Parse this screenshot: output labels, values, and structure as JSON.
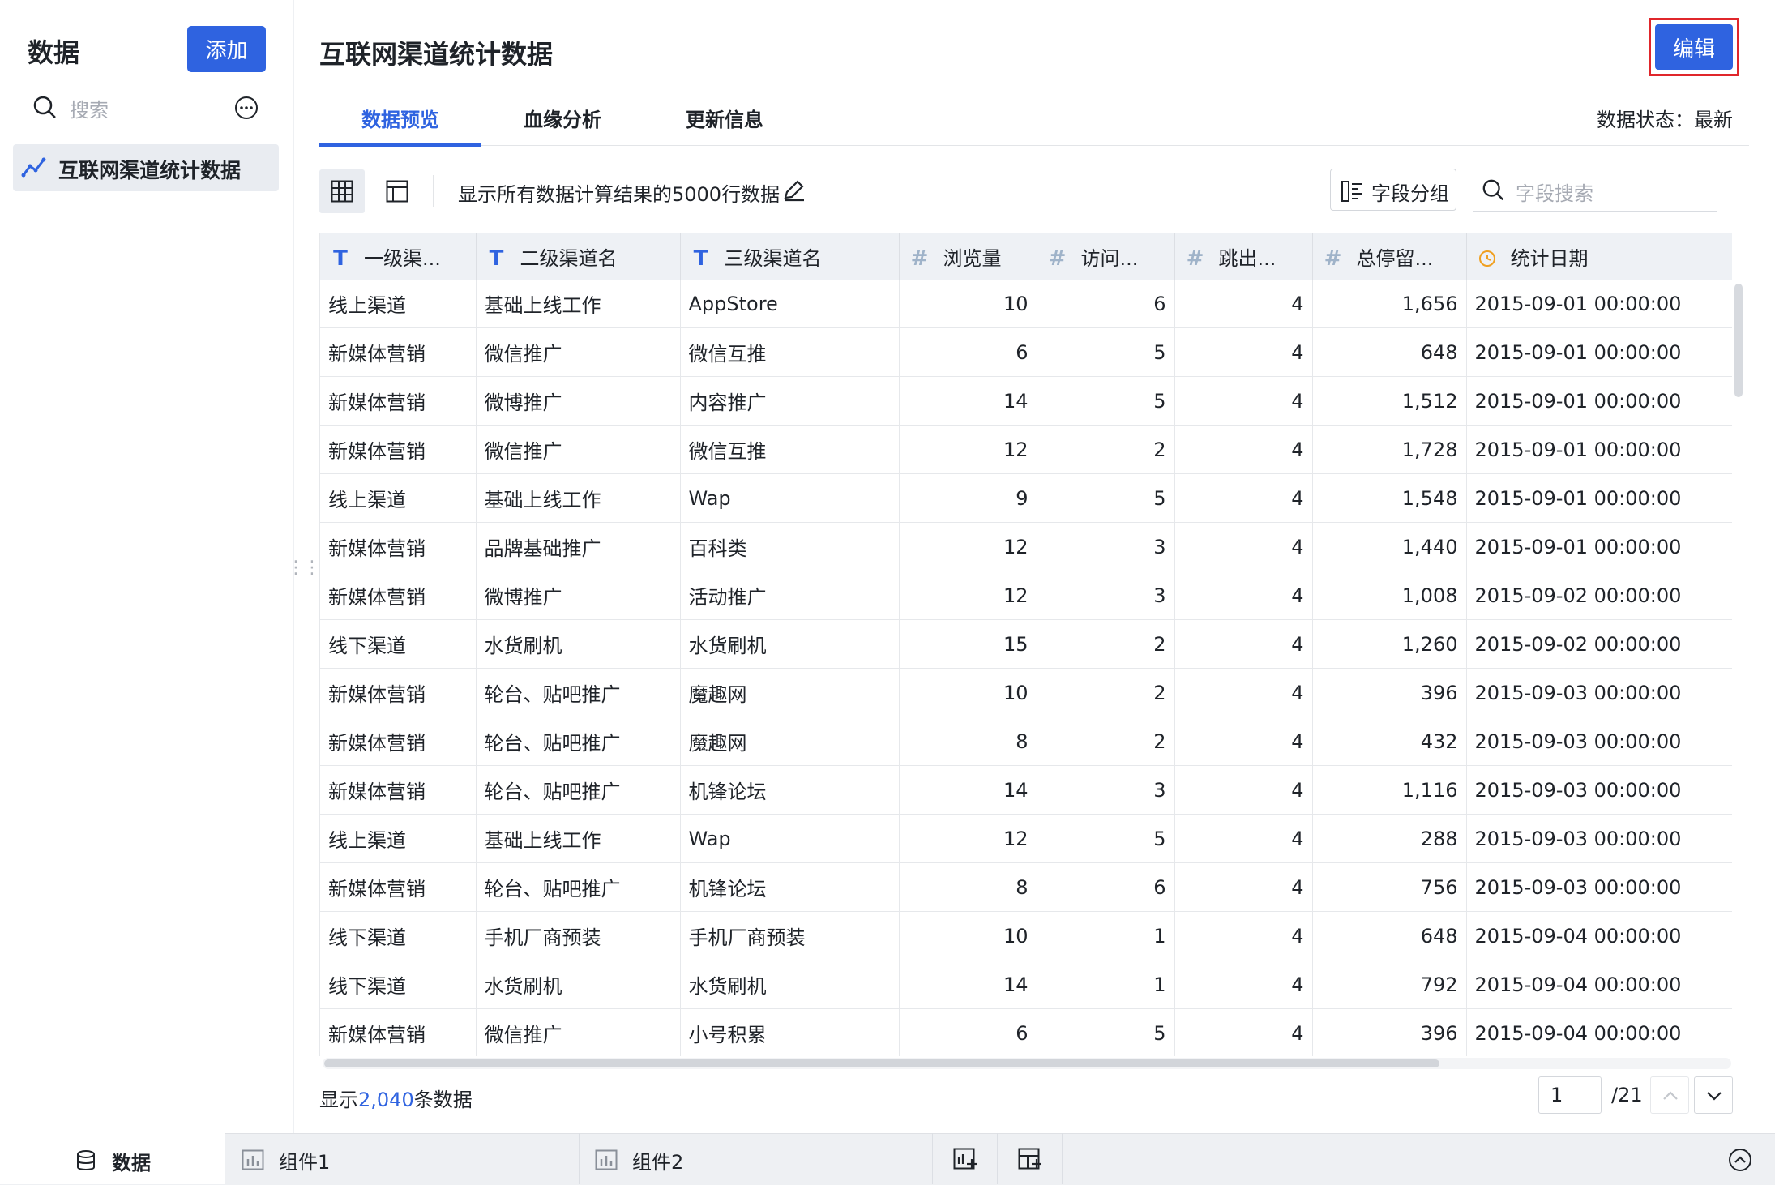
{
  "sidebar": {
    "title": "数据",
    "add_label": "添加",
    "search_placeholder": "搜索",
    "datasets": [
      {
        "label": "互联网渠道统计数据"
      }
    ]
  },
  "header": {
    "title": "互联网渠道统计数据",
    "edit_label": "编辑"
  },
  "tabs": [
    {
      "label": "数据预览",
      "active": true
    },
    {
      "label": "血缘分析",
      "active": false
    },
    {
      "label": "更新信息",
      "active": false
    }
  ],
  "status_text": "数据状态：最新",
  "toolbar": {
    "row_note": "显示所有数据计算结果的5000行数据",
    "group_label": "字段分组",
    "field_search_placeholder": "字段搜索"
  },
  "table": {
    "columns": [
      {
        "label": "一级渠...",
        "type": "text"
      },
      {
        "label": "二级渠道名",
        "type": "text"
      },
      {
        "label": "三级渠道名",
        "type": "text"
      },
      {
        "label": "浏览量",
        "type": "number"
      },
      {
        "label": "访问...",
        "type": "number"
      },
      {
        "label": "跳出...",
        "type": "number"
      },
      {
        "label": "总停留...",
        "type": "number"
      },
      {
        "label": "统计日期",
        "type": "date"
      }
    ],
    "rows": [
      [
        "线上渠道",
        "基础上线工作",
        "AppStore",
        "10",
        "6",
        "4",
        "1,656",
        "2015-09-01 00:00:00"
      ],
      [
        "新媒体营销",
        "微信推广",
        "微信互推",
        "6",
        "5",
        "4",
        "648",
        "2015-09-01 00:00:00"
      ],
      [
        "新媒体营销",
        "微博推广",
        "内容推广",
        "14",
        "5",
        "4",
        "1,512",
        "2015-09-01 00:00:00"
      ],
      [
        "新媒体营销",
        "微信推广",
        "微信互推",
        "12",
        "2",
        "4",
        "1,728",
        "2015-09-01 00:00:00"
      ],
      [
        "线上渠道",
        "基础上线工作",
        "Wap",
        "9",
        "5",
        "4",
        "1,548",
        "2015-09-01 00:00:00"
      ],
      [
        "新媒体营销",
        "品牌基础推广",
        "百科类",
        "12",
        "3",
        "4",
        "1,440",
        "2015-09-01 00:00:00"
      ],
      [
        "新媒体营销",
        "微博推广",
        "活动推广",
        "12",
        "3",
        "4",
        "1,008",
        "2015-09-02 00:00:00"
      ],
      [
        "线下渠道",
        "水货刷机",
        "水货刷机",
        "15",
        "2",
        "4",
        "1,260",
        "2015-09-02 00:00:00"
      ],
      [
        "新媒体营销",
        "轮台、贴吧推广",
        "魔趣网",
        "10",
        "2",
        "4",
        "396",
        "2015-09-03 00:00:00"
      ],
      [
        "新媒体营销",
        "轮台、贴吧推广",
        "魔趣网",
        "8",
        "2",
        "4",
        "432",
        "2015-09-03 00:00:00"
      ],
      [
        "新媒体营销",
        "轮台、贴吧推广",
        "机锋论坛",
        "14",
        "3",
        "4",
        "1,116",
        "2015-09-03 00:00:00"
      ],
      [
        "线上渠道",
        "基础上线工作",
        "Wap",
        "12",
        "5",
        "4",
        "288",
        "2015-09-03 00:00:00"
      ],
      [
        "新媒体营销",
        "轮台、贴吧推广",
        "机锋论坛",
        "8",
        "6",
        "4",
        "756",
        "2015-09-03 00:00:00"
      ],
      [
        "线下渠道",
        "手机厂商预装",
        "手机厂商预装",
        "10",
        "1",
        "4",
        "648",
        "2015-09-04 00:00:00"
      ],
      [
        "线下渠道",
        "水货刷机",
        "水货刷机",
        "14",
        "1",
        "4",
        "792",
        "2015-09-04 00:00:00"
      ],
      [
        "新媒体营销",
        "微信推广",
        "小号积累",
        "6",
        "5",
        "4",
        "396",
        "2015-09-04 00:00:00"
      ]
    ]
  },
  "footer": {
    "count_prefix": "显示",
    "count_value": "2,040",
    "count_suffix": "条数据",
    "page_current": "1",
    "page_total": "/21"
  },
  "bottom_tabs": {
    "data_label": "数据",
    "components": [
      "组件1",
      "组件2"
    ]
  },
  "colors": {
    "accent": "#2f63e0",
    "highlight_frame": "#e0262b",
    "header_bg": "#eef1f5"
  }
}
